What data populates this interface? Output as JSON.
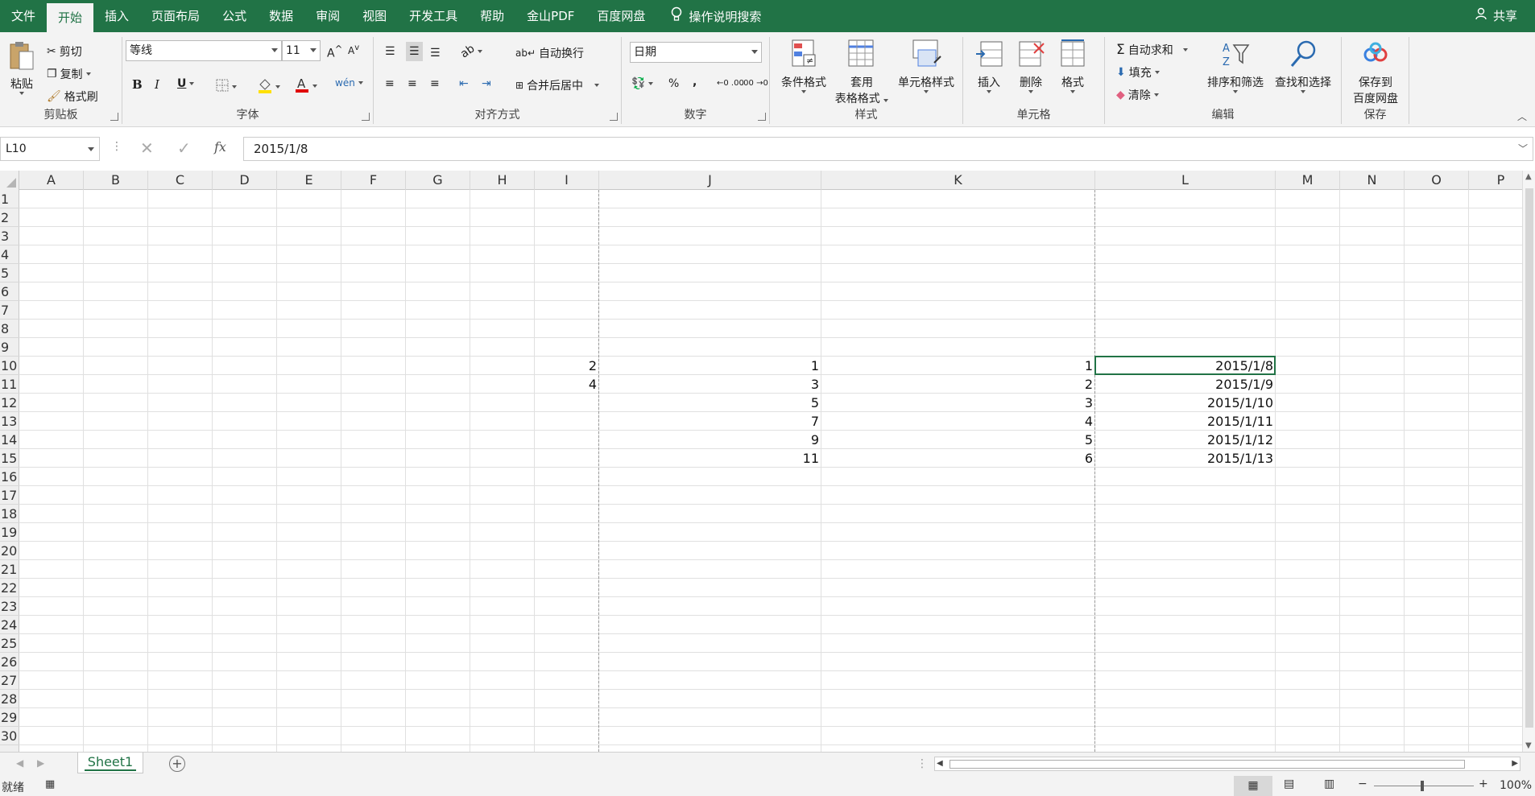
{
  "menu": {
    "tabs": [
      "文件",
      "开始",
      "插入",
      "页面布局",
      "公式",
      "数据",
      "审阅",
      "视图",
      "开发工具",
      "帮助",
      "金山PDF",
      "百度网盘"
    ],
    "active_tab": "开始",
    "search": "操作说明搜索",
    "share": "共享"
  },
  "ribbon": {
    "clipboard": {
      "paste": "粘贴",
      "cut": "剪切",
      "copy": "复制",
      "format_painter": "格式刷",
      "label": "剪贴板"
    },
    "font": {
      "name": "等线",
      "size": "11",
      "bold": "B",
      "italic": "I",
      "underline": "U",
      "label": "字体"
    },
    "alignment": {
      "wrap": "自动换行",
      "merge": "合并后居中",
      "label": "对齐方式"
    },
    "number": {
      "format": "日期",
      "percent": "%",
      "comma": ",",
      "label": "数字"
    },
    "styles": {
      "conditional": "条件格式",
      "table1": "套用",
      "table2": "表格格式",
      "cell_styles": "单元格样式",
      "label": "样式"
    },
    "cells": {
      "insert": "插入",
      "delete": "删除",
      "format": "格式",
      "label": "单元格"
    },
    "editing": {
      "autosum": "自动求和",
      "fill": "填充",
      "clear": "清除",
      "sort": "排序和筛选",
      "find": "查找和选择",
      "label": "编辑"
    },
    "save": {
      "line1": "保存到",
      "line2": "百度网盘",
      "label": "保存"
    }
  },
  "formula_bar": {
    "name_box": "L10",
    "fx": "fx",
    "value": "2015/1/8"
  },
  "grid": {
    "columns": [
      "A",
      "B",
      "C",
      "D",
      "E",
      "F",
      "G",
      "H",
      "I",
      "J",
      "K",
      "L",
      "M",
      "N",
      "O",
      "P"
    ],
    "rows": [
      "1",
      "2",
      "3",
      "4",
      "5",
      "6",
      "7",
      "8",
      "9",
      "10",
      "11",
      "12",
      "13",
      "14",
      "15",
      "16",
      "17",
      "18",
      "19",
      "20",
      "21",
      "22",
      "23",
      "24",
      "25",
      "26",
      "27",
      "28",
      "29",
      "30"
    ],
    "data": {
      "I": {
        "10": "2",
        "11": "4"
      },
      "J": {
        "10": "1",
        "11": "3",
        "12": "5",
        "13": "7",
        "14": "9",
        "15": "11"
      },
      "K": {
        "10": "1",
        "11": "2",
        "12": "3",
        "13": "4",
        "14": "5",
        "15": "6"
      },
      "L": {
        "10": "2015/1/8",
        "11": "2015/1/9",
        "12": "2015/1/10",
        "13": "2015/1/11",
        "14": "2015/1/12",
        "15": "2015/1/13"
      }
    }
  },
  "sheet_tabs": {
    "active": "Sheet1"
  },
  "status": {
    "ready": "就绪",
    "zoom": "100%"
  },
  "colors": {
    "accent": "#217346"
  }
}
